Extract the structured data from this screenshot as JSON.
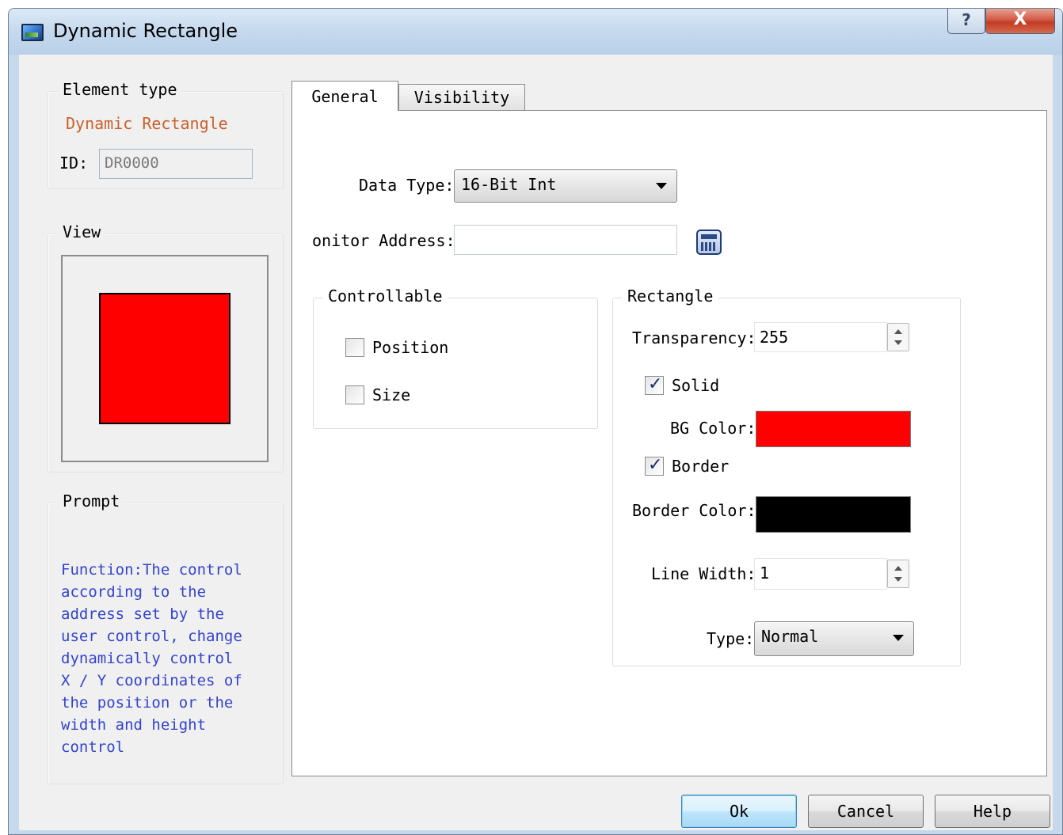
{
  "window": {
    "title": "Dynamic Rectangle",
    "help_glyph": "?",
    "close_glyph": "X"
  },
  "element_type": {
    "group_label": "Element type",
    "name": "Dynamic Rectangle",
    "id_label": "ID:",
    "id_value": "DR0000"
  },
  "view": {
    "group_label": "View",
    "preview_fill": "#ff0000",
    "preview_border": "#000000"
  },
  "prompt": {
    "group_label": "Prompt",
    "text": "Function:The control\naccording to the\naddress set by the\nuser control, change\ndynamically control\nX / Y coordinates of\nthe position or the\nwidth and height\ncontrol"
  },
  "tabs": [
    {
      "label": "General",
      "active": true
    },
    {
      "label": "Visibility",
      "active": false
    }
  ],
  "general": {
    "data_type_label": "Data Type:",
    "data_type_value": "16-Bit Int",
    "monitor_address_label": "onitor Address:",
    "monitor_address_value": "",
    "address_picker_icon": "calculator-icon",
    "controllable": {
      "group_label": "Controllable",
      "position_label": "Position",
      "position_checked": false,
      "size_label": "Size",
      "size_checked": false
    },
    "rectangle": {
      "group_label": "Rectangle",
      "transparency_label": "Transparency:",
      "transparency_value": "255",
      "solid_label": "Solid",
      "solid_checked": true,
      "bg_color_label": "BG Color:",
      "bg_color": "#ff0000",
      "border_label": "Border",
      "border_checked": true,
      "border_color_label": "Border Color:",
      "border_color": "#000000",
      "line_width_label": "Line Width:",
      "line_width_value": "1",
      "type_label": "Type:",
      "type_value": "Normal"
    }
  },
  "buttons": {
    "ok": "Ok",
    "cancel": "Cancel",
    "help": "Help"
  }
}
